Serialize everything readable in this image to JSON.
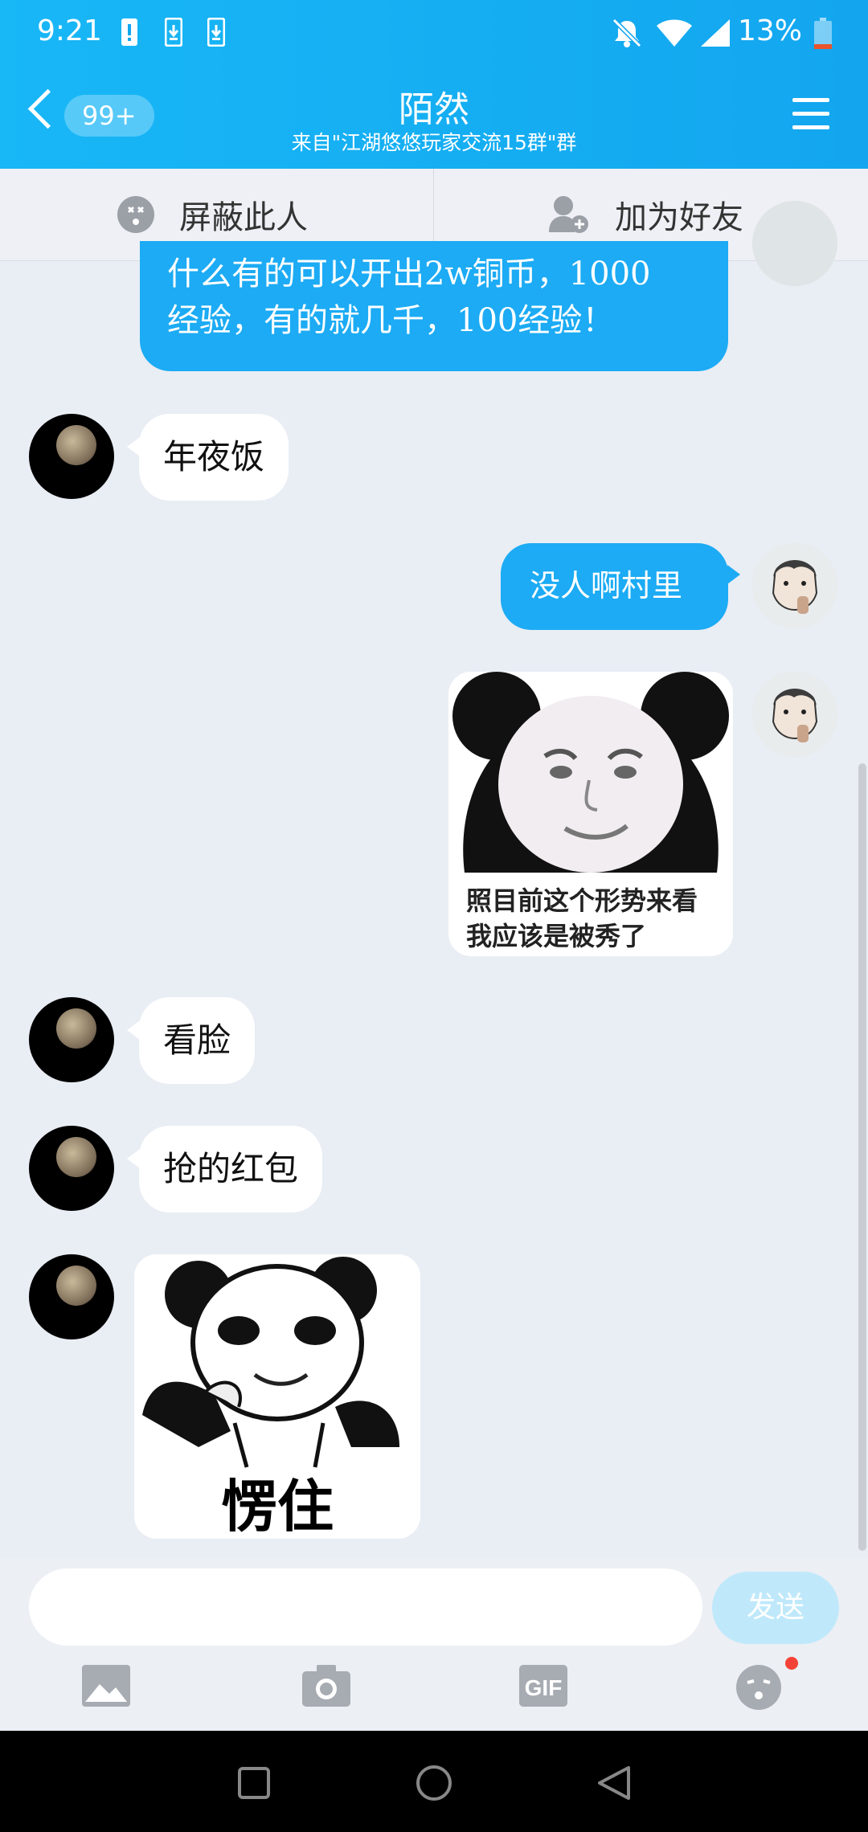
{
  "status_bar": {
    "time": "9:21",
    "battery": "13%"
  },
  "header": {
    "badge": "99+",
    "title": "陌然",
    "subtitle": "来自\"江湖悠悠玩家交流15群\"群"
  },
  "actions": {
    "block_label": "屏蔽此人",
    "add_friend_label": "加为好友"
  },
  "messages": {
    "m1": {
      "line1": "什么有的可以开出2w铜币，1000",
      "line2": "经验，有的就几千，100经验！"
    },
    "m2": "年夜饭",
    "m3": "没人啊村里",
    "m4_caption_line1": "照目前这个形势来看",
    "m4_caption_line2": "我应该是被秀了",
    "m5": "看脸",
    "m6": "抢的红包",
    "m7_caption": "愣住"
  },
  "input": {
    "placeholder": "",
    "send_label": "发送"
  },
  "toolbar": {
    "gif_label": "GIF"
  },
  "colors": {
    "header": "#18b7f6",
    "bubble_right": "#1cabf4",
    "send_disabled": "#bfe9fb"
  }
}
